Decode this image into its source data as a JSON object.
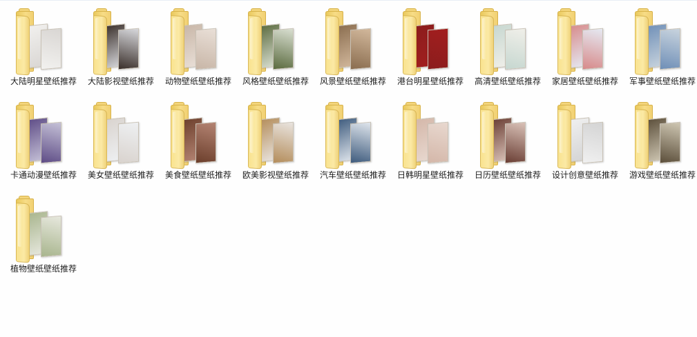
{
  "folders": [
    {
      "label": "大陆明星壁纸推荐",
      "icon": "folder-icon",
      "colors": [
        "#f2f1ef",
        "#d9d6d3"
      ]
    },
    {
      "label": "大陆影视壁纸推荐",
      "icon": "folder-icon",
      "colors": [
        "#3a2f2a",
        "#d7d8dc"
      ]
    },
    {
      "label": "动物壁纸壁纸推荐",
      "icon": "folder-icon",
      "colors": [
        "#c8b6a7",
        "#e9dfd7"
      ]
    },
    {
      "label": "风格壁纸壁纸推荐",
      "icon": "folder-icon",
      "colors": [
        "#5b6b3f",
        "#d9dfd1"
      ]
    },
    {
      "label": "风景壁纸壁纸推荐",
      "icon": "folder-icon",
      "colors": [
        "#8a6d4f",
        "#d2b89c"
      ]
    },
    {
      "label": "港台明星壁纸推荐",
      "icon": "folder-icon",
      "colors": [
        "#8b1d1d",
        "#a21e1e"
      ]
    },
    {
      "label": "高清壁纸壁纸推荐",
      "icon": "folder-icon",
      "colors": [
        "#c6d7d0",
        "#f0efe9"
      ]
    },
    {
      "label": "家居壁纸壁纸推荐",
      "icon": "folder-icon",
      "colors": [
        "#d78a8a",
        "#e5e9f2"
      ]
    },
    {
      "label": "军事壁纸壁纸推荐",
      "icon": "folder-icon",
      "colors": [
        "#6f8fb7",
        "#c9d4de"
      ]
    },
    {
      "label": "卡通动漫壁纸推荐",
      "icon": "folder-icon",
      "colors": [
        "#5e4c86",
        "#c5c1d7"
      ]
    },
    {
      "label": "美女壁纸壁纸推荐",
      "icon": "folder-icon",
      "colors": [
        "#d9d3ce",
        "#eef0f2"
      ]
    },
    {
      "label": "美食壁纸壁纸推荐",
      "icon": "folder-icon",
      "colors": [
        "#6c3f2c",
        "#b48473"
      ]
    },
    {
      "label": "欧美影视壁纸推荐",
      "icon": "folder-icon",
      "colors": [
        "#b48d5b",
        "#e9e4df"
      ]
    },
    {
      "label": "汽车壁纸壁纸推荐",
      "icon": "folder-icon",
      "colors": [
        "#3e5b7d",
        "#dfe5ec"
      ]
    },
    {
      "label": "日韩明星壁纸推荐",
      "icon": "folder-icon",
      "colors": [
        "#d4b7a9",
        "#e8d8cf"
      ]
    },
    {
      "label": "日历壁纸壁纸推荐",
      "icon": "folder-icon",
      "colors": [
        "#6a3e34",
        "#d9c1b7"
      ]
    },
    {
      "label": "设计创意壁纸推荐",
      "icon": "folder-icon",
      "colors": [
        "#f0f0f0",
        "#d4d4d4"
      ]
    },
    {
      "label": "游戏壁纸壁纸推荐",
      "icon": "folder-icon",
      "colors": [
        "#5b4e3a",
        "#cfc7b3"
      ]
    },
    {
      "label": "植物壁纸壁纸推荐",
      "icon": "folder-icon",
      "colors": [
        "#a8b58d",
        "#e7e8de"
      ]
    }
  ]
}
